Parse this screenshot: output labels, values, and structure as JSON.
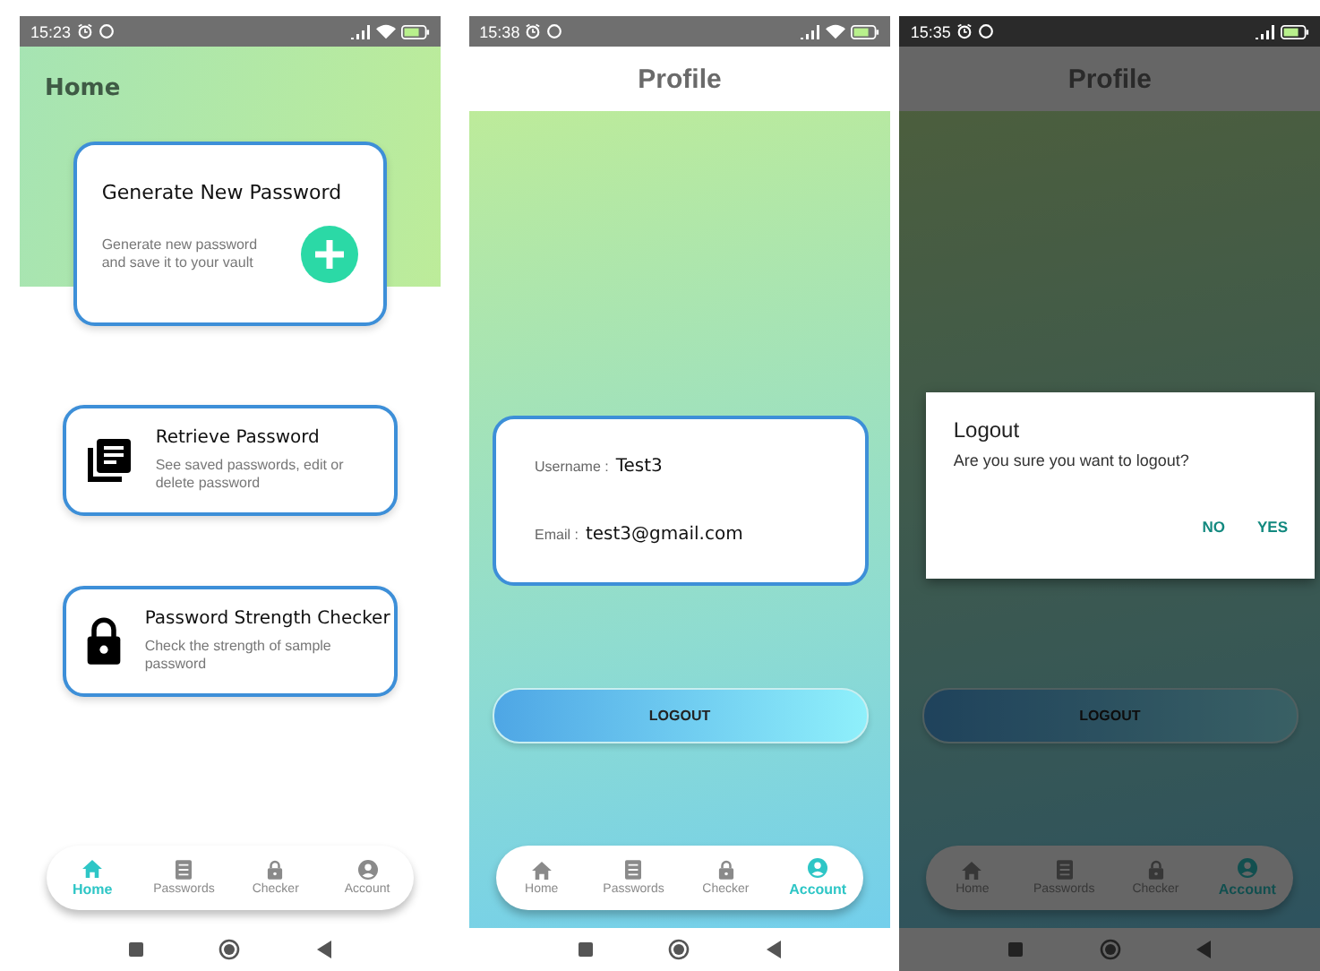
{
  "screens": [
    {
      "kind": "home",
      "status": {
        "time": "15:23",
        "wifi": true
      },
      "title": "Home",
      "cards": [
        {
          "kind": "generate",
          "title": "Generate New Password",
          "description": "Generate new password and save it to your vault"
        },
        {
          "kind": "retrieve",
          "title": "Retrieve Password",
          "description": "See saved passwords, edit or delete password"
        },
        {
          "kind": "strength",
          "title": "Password Strength Checker",
          "description": "Check the strength of sample password"
        }
      ],
      "nav": [
        {
          "kind": "home",
          "label": "Home",
          "selected": true
        },
        {
          "kind": "list",
          "label": "Passwords",
          "selected": false
        },
        {
          "kind": "lock",
          "label": "Checker",
          "selected": false
        },
        {
          "kind": "account",
          "label": "Account",
          "selected": false
        }
      ]
    },
    {
      "kind": "profile",
      "status": {
        "time": "15:38",
        "wifi": true
      },
      "title": "Profile",
      "profile": {
        "fields": [
          {
            "label": "Username :",
            "value": "Test3"
          },
          {
            "label": "Email :",
            "value": "test3@gmail.com"
          }
        ]
      },
      "logout": "LOGOUT",
      "nav": [
        {
          "kind": "home",
          "label": "Home",
          "selected": false
        },
        {
          "kind": "list",
          "label": "Passwords",
          "selected": false
        },
        {
          "kind": "lock",
          "label": "Checker",
          "selected": false
        },
        {
          "kind": "account",
          "label": "Account",
          "selected": true
        }
      ]
    },
    {
      "kind": "profile",
      "status": {
        "time": "15:35",
        "wifi": false
      },
      "title": "Profile",
      "logout": "LOGOUT",
      "dialog": {
        "title": "Logout",
        "message": "Are you sure you want to logout?",
        "buttons": [
          "NO",
          "YES"
        ]
      },
      "nav": [
        {
          "kind": "home",
          "label": "Home",
          "selected": false
        },
        {
          "kind": "list",
          "label": "Passwords",
          "selected": false
        },
        {
          "kind": "lock",
          "label": "Checker",
          "selected": false
        },
        {
          "kind": "account",
          "label": "Account",
          "selected": true
        }
      ]
    }
  ]
}
